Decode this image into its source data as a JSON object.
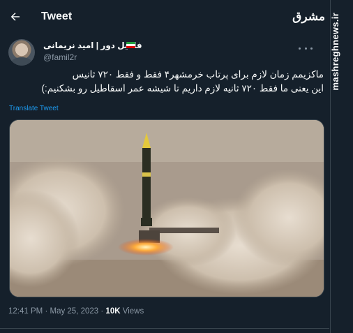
{
  "header": {
    "title": "Tweet",
    "back_icon": "arrow-left-icon"
  },
  "watermark": {
    "logo_text": "مشرق",
    "site": "mashreghnews.ir"
  },
  "author": {
    "display_name": "فامیل دور | امید نریمانی",
    "handle": "@famil2r",
    "flag_colors": [
      "#239f40",
      "#ffffff",
      "#da0000"
    ]
  },
  "tweet": {
    "lines": [
      "ماکزیمم زمان لازم برای پرتاب خرمشهر۴ فقط و فقط ۷۲۰ ثانیس",
      "این یعنی ما فقط ۷۲۰ ثانیه لازم داریم تا شیشه عمر اسقاطیل رو بشکنیم:)"
    ],
    "translate_label": "Translate Tweet"
  },
  "media": {
    "alt": "missile launch"
  },
  "meta": {
    "time": "12:41 PM",
    "separator": "·",
    "date": "May 25, 2023",
    "views_count": "10K",
    "views_label": "Views"
  },
  "colors": {
    "background": "#15202b",
    "accent": "#1d9bf0",
    "secondary_text": "#8b98a5"
  }
}
